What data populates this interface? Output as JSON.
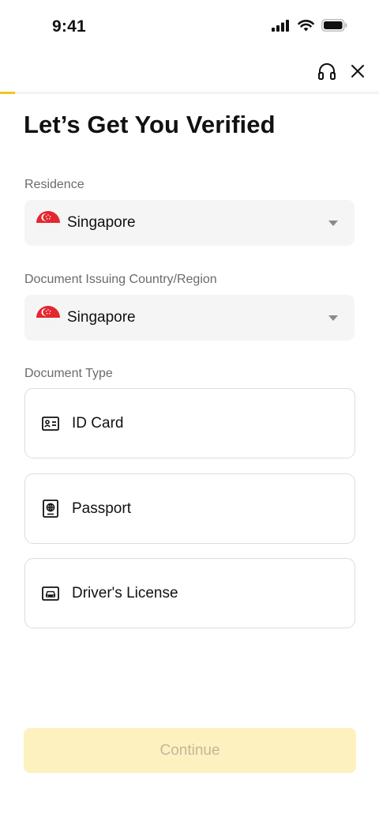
{
  "status_bar": {
    "time": "9:41"
  },
  "header": {
    "support_icon": "headset-icon",
    "close_icon": "close-icon",
    "progress": 0.04,
    "accent_color": "#f5c518"
  },
  "page": {
    "title": "Let’s Get You Verified"
  },
  "residence": {
    "label": "Residence",
    "value": "Singapore",
    "flag_icon": "singapore-flag-icon"
  },
  "issuing_country": {
    "label": "Document Issuing Country/Region",
    "value": "Singapore",
    "flag_icon": "singapore-flag-icon"
  },
  "document_type": {
    "label": "Document Type",
    "options": [
      {
        "label": "ID Card",
        "icon": "id-card-icon"
      },
      {
        "label": "Passport",
        "icon": "passport-icon"
      },
      {
        "label": "Driver's License",
        "icon": "drivers-license-icon"
      }
    ]
  },
  "footer": {
    "continue_label": "Continue",
    "continue_bg": "#fdf1bf",
    "continue_text_color": "#c2b89a"
  }
}
